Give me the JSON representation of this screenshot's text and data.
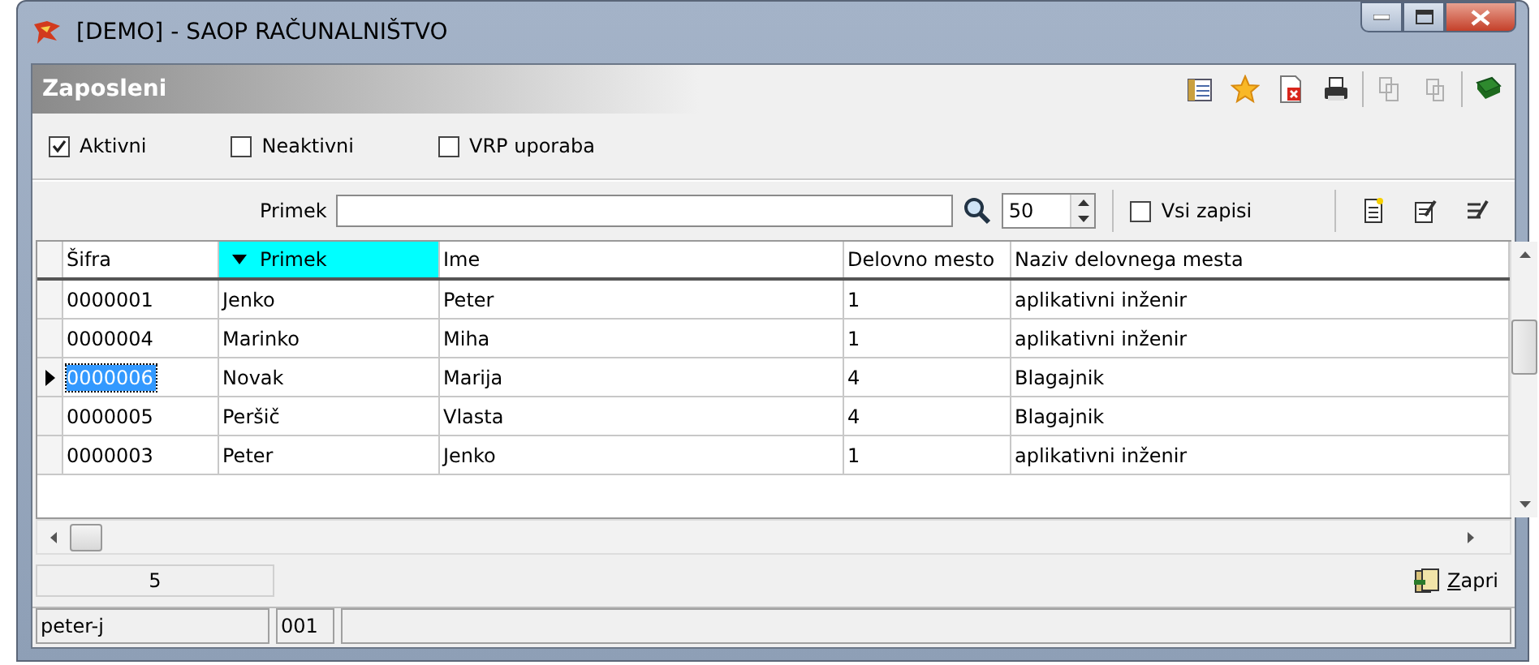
{
  "window": {
    "title": "[DEMO] - SAOP RAČUNALNIŠTVO"
  },
  "panel": {
    "title": "Zaposleni"
  },
  "toolbar": [
    {
      "kind": "columns",
      "disabled": false
    },
    {
      "kind": "star",
      "disabled": false
    },
    {
      "kind": "delete",
      "disabled": false
    },
    {
      "kind": "print",
      "disabled": false
    },
    {
      "kind": "copy",
      "disabled": true
    },
    {
      "kind": "paste",
      "disabled": true
    },
    {
      "kind": "help",
      "disabled": false
    }
  ],
  "filters": [
    {
      "label": "Aktivni",
      "checked": true
    },
    {
      "label": "Neaktivni",
      "checked": false
    },
    {
      "label": "VRP uporaba",
      "checked": false
    }
  ],
  "search": {
    "label": "Primek",
    "limit": "50",
    "all_records": {
      "label": "Vsi zapisi",
      "checked": false
    }
  },
  "record_tools": [
    {
      "kind": "new"
    },
    {
      "kind": "edit"
    },
    {
      "kind": "edit-all"
    }
  ],
  "table": {
    "columns": [
      {
        "label": "Šifra",
        "sorted": false
      },
      {
        "label": "Primek",
        "sorted": true
      },
      {
        "label": "Ime",
        "sorted": false
      },
      {
        "label": "Delovno mesto",
        "sorted": false
      },
      {
        "label": "Naziv delovnega mesta",
        "sorted": false
      }
    ],
    "rows": [
      {
        "cells": [
          "0000001",
          "Jenko",
          "Peter",
          "1",
          "aplikativni inženir"
        ],
        "selected": false
      },
      {
        "cells": [
          "0000004",
          "Marinko",
          "Miha",
          "1",
          "aplikativni inženir"
        ],
        "selected": false
      },
      {
        "cells": [
          "0000006",
          "Novak",
          "Marija",
          "4",
          "Blagajnik"
        ],
        "selected": true
      },
      {
        "cells": [
          "0000005",
          "Peršič",
          "Vlasta",
          "4",
          "Blagajnik"
        ],
        "selected": false
      },
      {
        "cells": [
          "0000003",
          "Peter",
          "Jenko",
          "1",
          "aplikativni inženir"
        ],
        "selected": false
      }
    ]
  },
  "count": "5",
  "close_button": "Zapri",
  "status_bar": [
    "peter-j",
    "001"
  ]
}
